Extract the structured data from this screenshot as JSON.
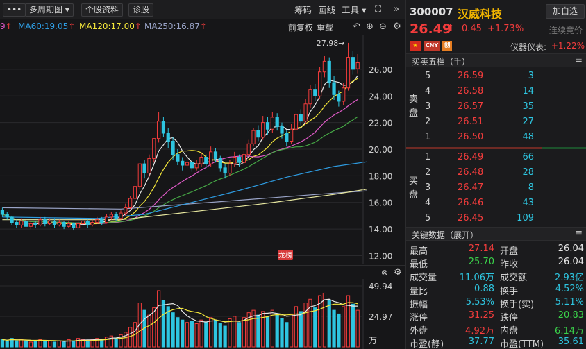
{
  "toolbar": {
    "more_label": "•••",
    "period_label": "多周期图",
    "stock_info_label": "个股资料",
    "diagnose_label": "诊股",
    "chip_label": "筹码",
    "draw_label": "画线",
    "tools_label": "工具",
    "expand_icon": "⛶",
    "collapse_icon": "»"
  },
  "ma_legend": {
    "ma_prefix": "9",
    "ma60": "MA60:19.05",
    "ma120": "MA120:17.00",
    "ma250": "MA250:16.87",
    "up_arrow": "↑",
    "adjust_label": "前复权",
    "overlay_label": "重载"
  },
  "colors": {
    "up": "#f23c3c",
    "down": "#2ec5e0",
    "ma5": "#e8e8e8",
    "ma10": "#f5e83a",
    "ma20": "#e05ac8",
    "ma30": "#46a846",
    "ma60": "#2e9be0",
    "ma120": "#e8e8a0",
    "ma250": "#9aa4c8",
    "stock_name": "#f0b400"
  },
  "chart_data": {
    "type": "candlestick",
    "y_ticks": [
      "26.00",
      "24.00",
      "22.00",
      "20.00",
      "18.00",
      "16.00",
      "14.00",
      "12.00"
    ],
    "ylim": [
      11.4,
      28.6
    ],
    "high_marker": "27.98",
    "dragon_tiger_badge": "龙榜",
    "volume_ticks": [
      "49.94",
      "24.97"
    ],
    "volume_unit": "万",
    "volume_max": 49.94,
    "candles": [
      {
        "o": 15.4,
        "c": 15.1,
        "h": 15.6,
        "l": 14.9
      },
      {
        "o": 15.1,
        "c": 14.9,
        "h": 15.3,
        "l": 14.7
      },
      {
        "o": 14.9,
        "c": 14.5,
        "h": 15.0,
        "l": 14.3
      },
      {
        "o": 14.5,
        "c": 14.3,
        "h": 14.7,
        "l": 14.1
      },
      {
        "o": 14.3,
        "c": 14.6,
        "h": 14.8,
        "l": 14.1
      },
      {
        "o": 14.6,
        "c": 14.2,
        "h": 14.8,
        "l": 14.0
      },
      {
        "o": 14.2,
        "c": 14.4,
        "h": 14.6,
        "l": 14.0
      },
      {
        "o": 14.4,
        "c": 14.3,
        "h": 14.6,
        "l": 14.1
      },
      {
        "o": 14.3,
        "c": 14.7,
        "h": 14.9,
        "l": 14.2
      },
      {
        "o": 14.7,
        "c": 14.4,
        "h": 14.9,
        "l": 14.2
      },
      {
        "o": 14.4,
        "c": 14.6,
        "h": 14.8,
        "l": 14.3
      },
      {
        "o": 14.6,
        "c": 14.3,
        "h": 14.8,
        "l": 14.1
      },
      {
        "o": 14.3,
        "c": 14.5,
        "h": 14.7,
        "l": 14.2
      },
      {
        "o": 14.5,
        "c": 14.2,
        "h": 14.6,
        "l": 14.0
      },
      {
        "o": 14.2,
        "c": 14.4,
        "h": 14.6,
        "l": 14.1
      },
      {
        "o": 14.4,
        "c": 14.1,
        "h": 14.5,
        "l": 13.9
      },
      {
        "o": 14.1,
        "c": 14.4,
        "h": 14.6,
        "l": 14.0
      },
      {
        "o": 14.4,
        "c": 14.6,
        "h": 14.8,
        "l": 14.3
      },
      {
        "o": 14.6,
        "c": 14.3,
        "h": 14.7,
        "l": 14.1
      },
      {
        "o": 14.3,
        "c": 14.5,
        "h": 14.7,
        "l": 14.2
      },
      {
        "o": 14.5,
        "c": 14.7,
        "h": 14.9,
        "l": 14.4
      },
      {
        "o": 14.7,
        "c": 14.5,
        "h": 14.9,
        "l": 14.3
      },
      {
        "o": 14.5,
        "c": 14.9,
        "h": 15.1,
        "l": 14.4
      },
      {
        "o": 14.9,
        "c": 15.1,
        "h": 15.3,
        "l": 14.7
      },
      {
        "o": 15.1,
        "c": 14.8,
        "h": 15.3,
        "l": 14.6
      },
      {
        "o": 14.8,
        "c": 15.2,
        "h": 15.4,
        "l": 14.7
      },
      {
        "o": 15.2,
        "c": 15.6,
        "h": 15.9,
        "l": 15.0
      },
      {
        "o": 15.6,
        "c": 16.3,
        "h": 16.5,
        "l": 15.5
      },
      {
        "o": 16.3,
        "c": 17.2,
        "h": 17.5,
        "l": 16.1
      },
      {
        "o": 17.2,
        "c": 18.9,
        "h": 18.9,
        "l": 17.0
      },
      {
        "o": 18.9,
        "c": 18.2,
        "h": 19.2,
        "l": 17.8
      },
      {
        "o": 18.2,
        "c": 19.3,
        "h": 19.6,
        "l": 17.9
      },
      {
        "o": 19.3,
        "c": 20.8,
        "h": 20.8,
        "l": 19.0
      },
      {
        "o": 20.8,
        "c": 22.1,
        "h": 22.8,
        "l": 20.5
      },
      {
        "o": 22.1,
        "c": 21.2,
        "h": 22.4,
        "l": 20.9
      },
      {
        "o": 21.2,
        "c": 20.6,
        "h": 21.6,
        "l": 20.1
      },
      {
        "o": 20.6,
        "c": 19.6,
        "h": 20.9,
        "l": 19.2
      },
      {
        "o": 19.6,
        "c": 19.1,
        "h": 20.0,
        "l": 18.8
      },
      {
        "o": 19.1,
        "c": 18.8,
        "h": 19.4,
        "l": 18.4
      },
      {
        "o": 18.8,
        "c": 19.0,
        "h": 19.3,
        "l": 18.5
      },
      {
        "o": 19.0,
        "c": 18.6,
        "h": 19.2,
        "l": 18.3
      },
      {
        "o": 18.6,
        "c": 18.9,
        "h": 19.2,
        "l": 18.4
      },
      {
        "o": 18.9,
        "c": 19.4,
        "h": 19.7,
        "l": 18.7
      },
      {
        "o": 19.4,
        "c": 18.9,
        "h": 19.6,
        "l": 18.6
      },
      {
        "o": 18.9,
        "c": 19.8,
        "h": 20.2,
        "l": 18.7
      },
      {
        "o": 19.8,
        "c": 19.3,
        "h": 20.1,
        "l": 19.0
      },
      {
        "o": 19.3,
        "c": 18.6,
        "h": 19.5,
        "l": 18.3
      },
      {
        "o": 18.6,
        "c": 18.2,
        "h": 18.9,
        "l": 17.8
      },
      {
        "o": 18.2,
        "c": 18.9,
        "h": 19.2,
        "l": 18.0
      },
      {
        "o": 18.9,
        "c": 19.4,
        "h": 19.8,
        "l": 18.7
      },
      {
        "o": 19.4,
        "c": 19.0,
        "h": 19.6,
        "l": 18.7
      },
      {
        "o": 19.0,
        "c": 19.6,
        "h": 19.9,
        "l": 18.8
      },
      {
        "o": 19.6,
        "c": 20.4,
        "h": 20.7,
        "l": 19.4
      },
      {
        "o": 20.4,
        "c": 21.4,
        "h": 21.6,
        "l": 20.2
      },
      {
        "o": 21.4,
        "c": 20.9,
        "h": 21.8,
        "l": 20.6
      },
      {
        "o": 20.9,
        "c": 22.0,
        "h": 22.5,
        "l": 20.7
      },
      {
        "o": 22.0,
        "c": 21.5,
        "h": 22.4,
        "l": 21.1
      },
      {
        "o": 21.5,
        "c": 22.4,
        "h": 22.8,
        "l": 21.2
      },
      {
        "o": 22.4,
        "c": 21.7,
        "h": 22.7,
        "l": 21.4
      },
      {
        "o": 21.7,
        "c": 21.2,
        "h": 22.0,
        "l": 20.8
      },
      {
        "o": 21.2,
        "c": 20.6,
        "h": 21.4,
        "l": 20.2
      },
      {
        "o": 20.6,
        "c": 21.5,
        "h": 21.9,
        "l": 20.4
      },
      {
        "o": 21.5,
        "c": 22.6,
        "h": 22.9,
        "l": 21.3
      },
      {
        "o": 22.6,
        "c": 22.1,
        "h": 23.0,
        "l": 21.8
      },
      {
        "o": 22.1,
        "c": 23.4,
        "h": 23.8,
        "l": 21.9
      },
      {
        "o": 23.4,
        "c": 24.5,
        "h": 24.8,
        "l": 23.1
      },
      {
        "o": 24.5,
        "c": 24.0,
        "h": 24.9,
        "l": 23.6
      },
      {
        "o": 24.0,
        "c": 25.8,
        "h": 26.2,
        "l": 23.8
      },
      {
        "o": 25.8,
        "c": 26.6,
        "h": 27.0,
        "l": 25.4
      },
      {
        "o": 26.6,
        "c": 25.0,
        "h": 26.9,
        "l": 24.6
      },
      {
        "o": 25.0,
        "c": 24.1,
        "h": 25.5,
        "l": 23.7
      },
      {
        "o": 24.1,
        "c": 23.6,
        "h": 24.4,
        "l": 23.2
      },
      {
        "o": 23.6,
        "c": 24.6,
        "h": 25.0,
        "l": 23.3
      },
      {
        "o": 24.6,
        "c": 26.9,
        "h": 27.98,
        "l": 24.4
      },
      {
        "o": 26.9,
        "c": 26.0,
        "h": 27.4,
        "l": 25.6
      },
      {
        "o": 26.04,
        "c": 26.49,
        "h": 27.14,
        "l": 25.7
      }
    ],
    "volumes": [
      6,
      5,
      7,
      5,
      6,
      5,
      4,
      5,
      6,
      5,
      5,
      4,
      5,
      4,
      6,
      5,
      7,
      6,
      5,
      6,
      7,
      6,
      8,
      9,
      7,
      10,
      12,
      16,
      20,
      36,
      30,
      26,
      32,
      46,
      38,
      33,
      28,
      24,
      22,
      20,
      21,
      19,
      22,
      20,
      24,
      22,
      19,
      17,
      23,
      25,
      20,
      24,
      28,
      30,
      26,
      29,
      25,
      30,
      27,
      23,
      20,
      27,
      33,
      29,
      36,
      39,
      32,
      42,
      44,
      38,
      30,
      27,
      33,
      42,
      35,
      30
    ]
  },
  "ma_overlays": {
    "ma60_points": [
      [
        0,
        14.9
      ],
      [
        20,
        14.8
      ],
      [
        30,
        15.1
      ],
      [
        40,
        16.0
      ],
      [
        50,
        16.9
      ],
      [
        60,
        17.9
      ],
      [
        70,
        18.7
      ],
      [
        77,
        19.05
      ]
    ],
    "ma120_points": [
      [
        0,
        14.7
      ],
      [
        25,
        14.7
      ],
      [
        40,
        15.3
      ],
      [
        55,
        15.9
      ],
      [
        70,
        16.6
      ],
      [
        77,
        17.0
      ]
    ],
    "ma250_points": [
      [
        0,
        15.6
      ],
      [
        25,
        15.5
      ],
      [
        40,
        15.9
      ],
      [
        55,
        16.3
      ],
      [
        70,
        16.7
      ],
      [
        77,
        16.87
      ]
    ]
  },
  "quote": {
    "code": "300007",
    "name": "汉威科技",
    "add_watchlist": "加自选",
    "price": "26.49",
    "up_icon": "⬆",
    "change": "0.45",
    "change_pct": "+1.73%",
    "auction_label": "连续竞价",
    "flag_cn": "",
    "flag_cny": "CNY",
    "flag_board": "创",
    "sector_name": "仪器仪表:",
    "sector_pct": "+1.22%"
  },
  "orderbook": {
    "title": "买卖五档（手）",
    "sell_label": "卖盘",
    "buy_label": "买盘",
    "menu_icon": "≡",
    "asks": [
      {
        "level": "5",
        "price": "26.59",
        "vol": "3"
      },
      {
        "level": "4",
        "price": "26.58",
        "vol": "14"
      },
      {
        "level": "3",
        "price": "26.57",
        "vol": "35"
      },
      {
        "level": "2",
        "price": "26.51",
        "vol": "27"
      },
      {
        "level": "1",
        "price": "26.50",
        "vol": "48"
      }
    ],
    "bids": [
      {
        "level": "1",
        "price": "26.49",
        "vol": "66"
      },
      {
        "level": "2",
        "price": "26.48",
        "vol": "28"
      },
      {
        "level": "3",
        "price": "26.47",
        "vol": "8"
      },
      {
        "level": "4",
        "price": "26.46",
        "vol": "43"
      },
      {
        "level": "5",
        "price": "26.45",
        "vol": "109"
      }
    ]
  },
  "keydata": {
    "title": "关键数据（展开）",
    "menu_icon": "≡",
    "rows": [
      {
        "l1": "最高",
        "v1": "27.14",
        "c1": "#f23c3c",
        "l2": "开盘",
        "v2": "26.04",
        "c2": "#e8e8e8"
      },
      {
        "l1": "最低",
        "v1": "25.70",
        "c1": "#3ad14a",
        "l2": "昨收",
        "v2": "26.04",
        "c2": "#e8e8e8"
      },
      {
        "l1": "成交量",
        "v1": "11.06万",
        "c1": "#2ec5e0",
        "l2": "成交额",
        "v2": "2.93亿",
        "c2": "#2ec5e0"
      },
      {
        "l1": "量比",
        "v1": "0.88",
        "c1": "#2ec5e0",
        "l2": "换手",
        "v2": "4.52%",
        "c2": "#2ec5e0"
      },
      {
        "l1": "振幅",
        "v1": "5.53%",
        "c1": "#2ec5e0",
        "l2": "换手(实)",
        "v2": "5.11%",
        "c2": "#2ec5e0"
      },
      {
        "l1": "涨停",
        "v1": "31.25",
        "c1": "#f23c3c",
        "l2": "跌停",
        "v2": "20.83",
        "c2": "#3ad14a"
      },
      {
        "l1": "外盘",
        "v1": "4.92万",
        "c1": "#f23c3c",
        "l2": "内盘",
        "v2": "6.14万",
        "c2": "#3ad14a"
      },
      {
        "l1": "市盈(静)",
        "v1": "37.77",
        "c1": "#2ec5e0",
        "l2": "市盈(TTM)",
        "v2": "35.61",
        "c2": "#2ec5e0"
      }
    ]
  }
}
